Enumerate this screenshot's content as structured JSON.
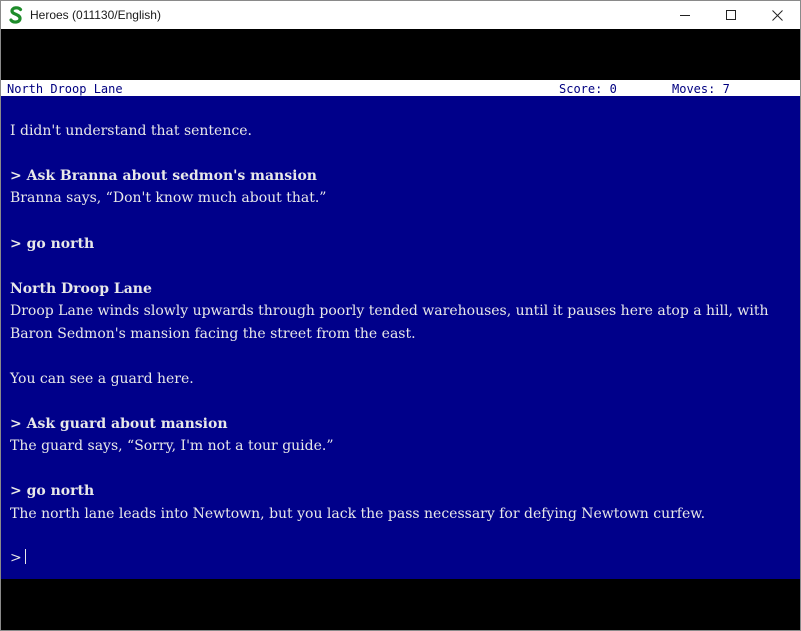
{
  "window": {
    "title": "Heroes (011130/English)",
    "controls": {
      "minimize": "minimize-icon",
      "maximize": "maximize-icon",
      "close": "close-icon"
    }
  },
  "status": {
    "location": "North Droop Lane",
    "score": "Score: 0",
    "moves": "Moves: 7"
  },
  "transcript": {
    "l1": "I didn't understand that sentence.",
    "l2": "> Ask Branna about sedmon's mansion",
    "l3": "Branna says, “Don't know much about that.”",
    "l4": "> go north",
    "l5": "North Droop Lane",
    "l6": "Droop Lane winds slowly upwards through poorly tended warehouses, until it pauses here atop a hill, with",
    "l7": "Baron Sedmon's mansion facing the street from the east.",
    "l8": "You can see a guard here.",
    "l9": "> Ask guard about mansion",
    "l10": "The guard says, “Sorry, I'm not a tour guide.”",
    "l11": "> go north",
    "l12": "The north lane leads into Newtown, but you lack the pass necessary for defying Newtown curfew.",
    "prompt": ">"
  },
  "colors": {
    "background": "#00008a",
    "text": "#e8e8e8",
    "statusbar_bg": "#ffffff",
    "statusbar_text": "#000080",
    "app_icon": "#1e8c2a"
  }
}
